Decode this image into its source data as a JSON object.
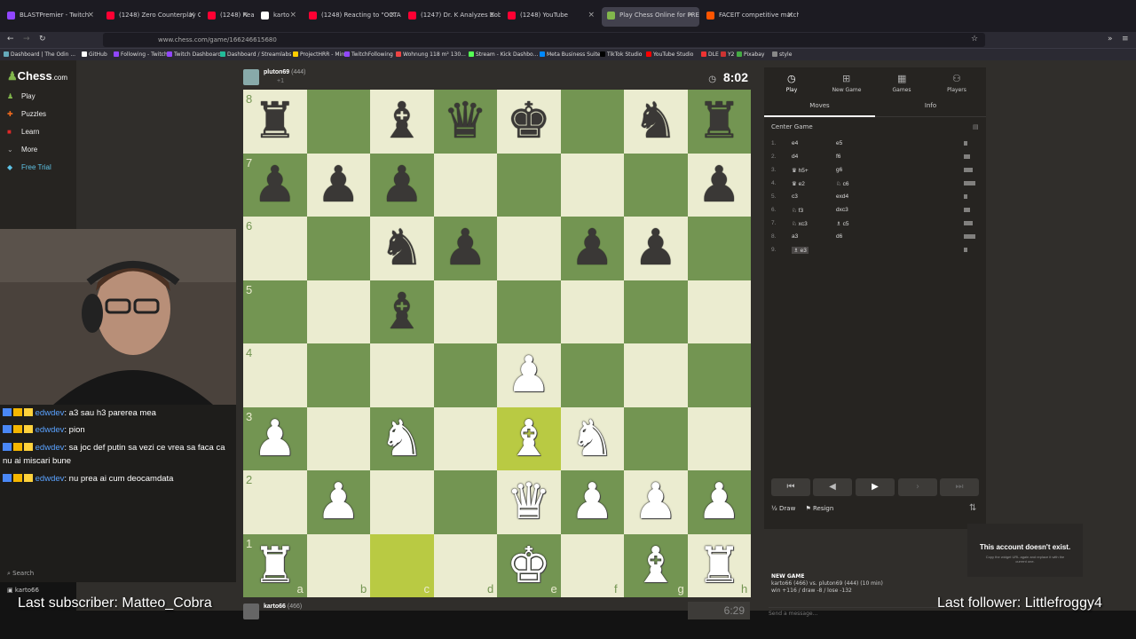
{
  "browser": {
    "tabs": [
      {
        "title": "BLASTPremier - Twitch",
        "color": "#9146ff"
      },
      {
        "title": "(1248) Zero Counterplay Onesl",
        "color": "#ff0033"
      },
      {
        "title": "(1248) React",
        "color": "#ff0033"
      },
      {
        "title": "karto",
        "color": "#ffffff"
      },
      {
        "title": "(1248) Reacting to \"OCTANE\" t",
        "color": "#ff0033"
      },
      {
        "title": "(1247) Dr. K Analyzes Bobby Le",
        "color": "#ff0033"
      },
      {
        "title": "(1248) YouTube",
        "color": "#ff0033"
      },
      {
        "title": "Play Chess Online for FREE - 2",
        "color": "#81b64c"
      },
      {
        "title": "FACEIT competitive match - FA",
        "color": "#ff5500"
      }
    ],
    "url": "www.chess.com/game/166246615680",
    "bookmarks": [
      "Dashboard | The Odin ...",
      "GitHub",
      "Following - Twitch",
      "Twitch Dashboard",
      "Dashboard / Streamlabs",
      "ProjectHRR - Miro",
      "TwitchFollowing",
      "Wohnung 118 m² 130...",
      "Stream - Kick Dashbo...",
      "Meta Business Suite",
      "TikTok Studio",
      "YouTube Studio",
      "DLE",
      "Y2",
      "Pixabay",
      "style"
    ]
  },
  "sidebar": {
    "logo_prefix": "Chess",
    "logo_suffix": ".com",
    "items": [
      {
        "label": "Play",
        "icon": "pawn-icon"
      },
      {
        "label": "Puzzles",
        "icon": "puzzle-icon"
      },
      {
        "label": "Learn",
        "icon": "learn-icon"
      },
      {
        "label": "More",
        "icon": "chevron-icon"
      },
      {
        "label": "Free Trial",
        "icon": "diamond-icon"
      }
    ],
    "search": "Search",
    "username": "karto66"
  },
  "chat": [
    {
      "user": "edwdev",
      "text": ": a3 sau h3 parerea mea"
    },
    {
      "user": "edwdev",
      "text": ": pion"
    },
    {
      "user": "edwdev",
      "text": ": sa joc def putin sa vezi ce vrea sa faca ca nu ai miscari bune"
    },
    {
      "user": "edwdev",
      "text": ": nu prea ai cum deocamdata"
    }
  ],
  "players": {
    "top": {
      "name": "pluton69",
      "rating": "(444)",
      "sub": "+1",
      "clock": "8:02"
    },
    "bottom": {
      "name": "karto66",
      "rating": "(466)",
      "clock": "6:29"
    }
  },
  "board": {
    "rank_labels": [
      "8",
      "7",
      "6",
      "5",
      "4",
      "3",
      "2",
      "1"
    ],
    "file_labels": [
      "a",
      "b",
      "c",
      "d",
      "e",
      "f",
      "g",
      "h"
    ],
    "position": [
      "r.bqk.nr",
      "ppp....p",
      "..np.pp.",
      "..b.....",
      "....P...",
      "P.N.BN..",
      ".P..QPPP",
      "R...K.BR"
    ],
    "highlights": [
      [
        5,
        4
      ],
      [
        7,
        2
      ]
    ]
  },
  "right_panel": {
    "nav": [
      {
        "label": "Play",
        "icon": "clock-icon"
      },
      {
        "label": "New Game",
        "icon": "plus-icon"
      },
      {
        "label": "Games",
        "icon": "games-icon"
      },
      {
        "label": "Players",
        "icon": "players-icon"
      }
    ],
    "tabs": [
      "Moves",
      "Info"
    ],
    "opening": "Center Game",
    "moves": [
      {
        "n": "1.",
        "w": "e4",
        "b": "e5"
      },
      {
        "n": "2.",
        "w": "d4",
        "b": "f6"
      },
      {
        "n": "3.",
        "w": "♛ h5+",
        "b": "g6"
      },
      {
        "n": "4.",
        "w": "♛ e2",
        "b": "♘ c6"
      },
      {
        "n": "5.",
        "w": "c3",
        "b": "exd4"
      },
      {
        "n": "6.",
        "w": "♘ f3",
        "b": "dxc3"
      },
      {
        "n": "7.",
        "w": "♘ xc3",
        "b": "♗ c5"
      },
      {
        "n": "8.",
        "w": "a3",
        "b": "d6"
      },
      {
        "n": "9.",
        "w": "♗ e3",
        "b": ""
      }
    ],
    "draw": "Draw",
    "resign": "Resign",
    "new_game": {
      "title": "NEW GAME",
      "line1": "karto66 (466) vs. pluton69 (444) (10 min)",
      "line2": "win +116 / draw -8 / lose -132"
    },
    "send_placeholder": "Send a message...",
    "toast_title": "This account doesn't exist.",
    "toast_body": "Copy the widget URL again and replace it with the current one."
  },
  "overlays": {
    "subscriber": "Last subscriber: Matteo_Cobra",
    "follower": "Last follower: Littlefroggy4"
  }
}
